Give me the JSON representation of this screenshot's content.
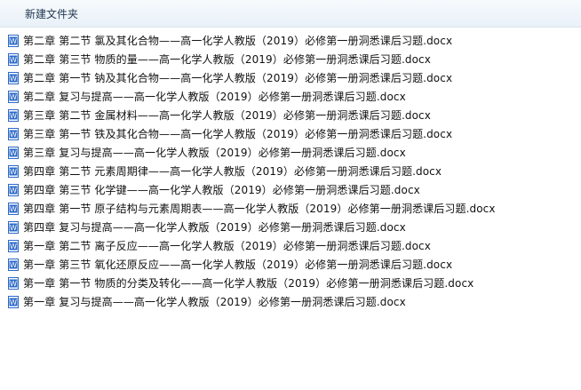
{
  "toolbar": {
    "new_folder_label": "新建文件夹"
  },
  "icons": {
    "file_type": "word-document-icon",
    "accent": "#2b69c8"
  },
  "files": [
    "第二章  第二节  氯及其化合物——高一化学人教版（2019）必修第一册洞悉课后习题.docx",
    "第二章  第三节  物质的量——高一化学人教版（2019）必修第一册洞悉课后习题.docx",
    "第二章  第一节  钠及其化合物——高一化学人教版（2019）必修第一册洞悉课后习题.docx",
    "第二章  复习与提高——高一化学人教版（2019）必修第一册洞悉课后习题.docx",
    "第三章  第二节  金属材料——高一化学人教版（2019）必修第一册洞悉课后习题.docx",
    "第三章  第一节  铁及其化合物——高一化学人教版（2019）必修第一册洞悉课后习题.docx",
    "第三章  复习与提高——高一化学人教版（2019）必修第一册洞悉课后习题.docx",
    "第四章  第二节  元素周期律——高一化学人教版（2019）必修第一册洞悉课后习题.docx",
    "第四章  第三节  化学键——高一化学人教版（2019）必修第一册洞悉课后习题.docx",
    "第四章  第一节  原子结构与元素周期表——高一化学人教版（2019）必修第一册洞悉课后习题.docx",
    "第四章  复习与提高——高一化学人教版（2019）必修第一册洞悉课后习题.docx",
    "第一章  第二节  离子反应——高一化学人教版（2019）必修第一册洞悉课后习题.docx",
    "第一章  第三节  氧化还原反应——高一化学人教版（2019）必修第一册洞悉课后习题.docx",
    "第一章  第一节  物质的分类及转化——高一化学人教版（2019）必修第一册洞悉课后习题.docx",
    "第一章  复习与提高——高一化学人教版（2019）必修第一册洞悉课后习题.docx"
  ]
}
